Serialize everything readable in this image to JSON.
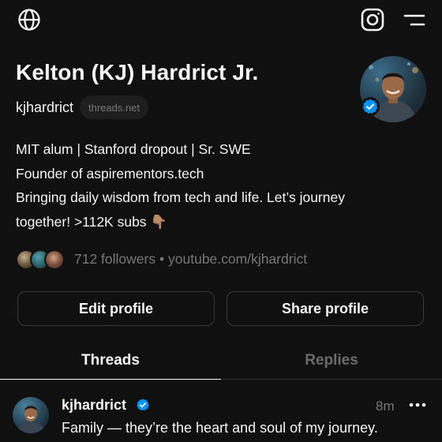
{
  "icons": {
    "globe": "globe-icon",
    "instagram": "instagram-icon",
    "menu": "menu-icon",
    "verified": "verified-badge-icon",
    "more": "more-icon"
  },
  "colors": {
    "background": "#101010",
    "text_primary": "#f3f5f7",
    "text_secondary": "#777777",
    "verified": "#0095f6",
    "button_border": "#3a3a3a"
  },
  "profile": {
    "name": "Kelton (KJ) Hardrict Jr.",
    "handle": "kjhardrict",
    "domain_badge": "threads.net",
    "verified": true,
    "bio_lines": [
      "MIT alum | Stanford dropout | Sr. SWE",
      "Founder of aspirementors.tech",
      "Bringing daily wisdom from tech and life. Let’s journey",
      "together! >112K subs 👇🏽"
    ],
    "followers": "712 followers",
    "separator": "•",
    "link": "youtube.com/kjhardrict"
  },
  "actions": {
    "edit_label": "Edit profile",
    "share_label": "Share profile"
  },
  "tabs": [
    {
      "label": "Threads",
      "active": true
    },
    {
      "label": "Replies",
      "active": false
    }
  ],
  "post": {
    "author": "kjhardrict",
    "time": "8m",
    "text": "Family — they’re the heart and soul of my journey."
  }
}
